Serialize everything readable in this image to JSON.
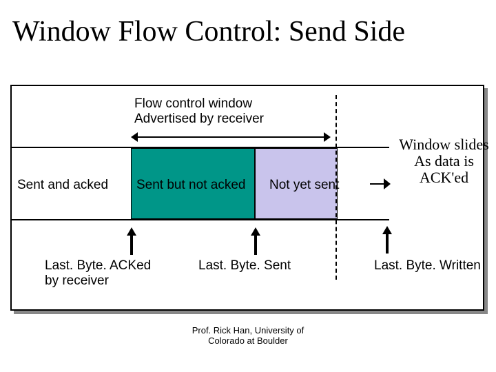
{
  "title": "Window Flow Control: Send Side",
  "flow_control_label_l1": "Flow control window",
  "flow_control_label_l2": "Advertised by receiver",
  "regions": {
    "sent_acked": "Sent and acked",
    "sent_not_acked": "Sent but not acked",
    "not_yet_sent": "Not yet sent"
  },
  "slides_l1": "Window slides",
  "slides_l2": "As data is",
  "slides_l3": "ACK'ed",
  "pointers": {
    "acked_l1": "Last. Byte. ACKed",
    "acked_l2": "by receiver",
    "sent": "Last. Byte. Sent",
    "written": "Last. Byte. Written"
  },
  "footer_l1": "Prof. Rick Han, University of",
  "footer_l2": "Colorado at Boulder"
}
